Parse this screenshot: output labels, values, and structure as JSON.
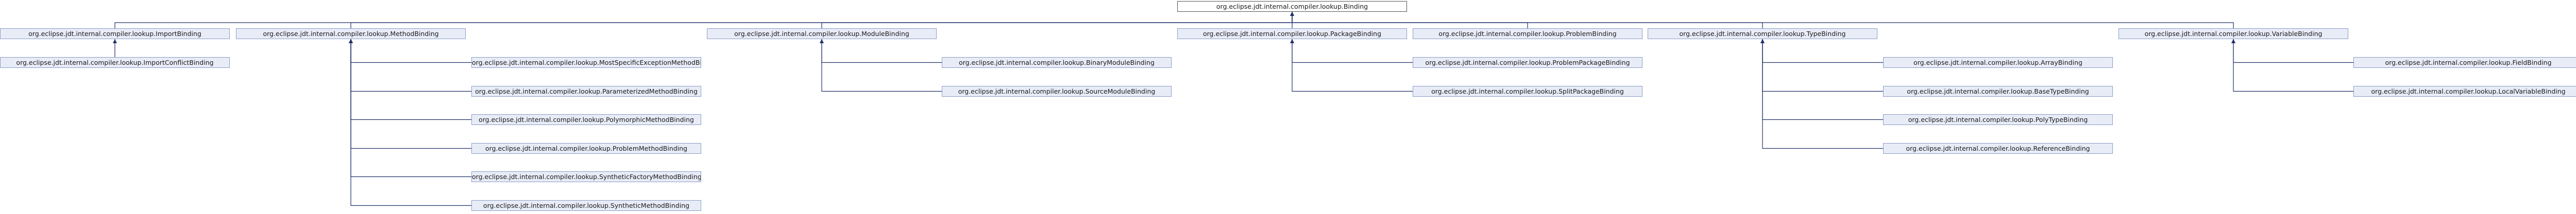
{
  "diagram": {
    "root": "org.eclipse.jdt.internal.compiler.lookup.Binding",
    "nodes": [
      {
        "id": "binding",
        "label": "org.eclipse.jdt.internal.compiler.lookup.Binding"
      },
      {
        "id": "import",
        "label": "org.eclipse.jdt.internal.compiler.lookup.ImportBinding"
      },
      {
        "id": "method",
        "label": "org.eclipse.jdt.internal.compiler.lookup.MethodBinding"
      },
      {
        "id": "module",
        "label": "org.eclipse.jdt.internal.compiler.lookup.ModuleBinding"
      },
      {
        "id": "package",
        "label": "org.eclipse.jdt.internal.compiler.lookup.PackageBinding"
      },
      {
        "id": "problem",
        "label": "org.eclipse.jdt.internal.compiler.lookup.ProblemBinding"
      },
      {
        "id": "type",
        "label": "org.eclipse.jdt.internal.compiler.lookup.TypeBinding"
      },
      {
        "id": "variable",
        "label": "org.eclipse.jdt.internal.compiler.lookup.VariableBinding"
      },
      {
        "id": "importConflict",
        "label": "org.eclipse.jdt.internal.compiler.lookup.ImportConflictBinding"
      },
      {
        "id": "mostSpecific",
        "label": "org.eclipse.jdt.internal.compiler.lookup.MostSpecificExceptionMethodBinding"
      },
      {
        "id": "parameterized",
        "label": "org.eclipse.jdt.internal.compiler.lookup.ParameterizedMethodBinding"
      },
      {
        "id": "polymorphic",
        "label": "org.eclipse.jdt.internal.compiler.lookup.PolymorphicMethodBinding"
      },
      {
        "id": "problemMethod",
        "label": "org.eclipse.jdt.internal.compiler.lookup.ProblemMethodBinding"
      },
      {
        "id": "syntheticFactory",
        "label": "org.eclipse.jdt.internal.compiler.lookup.SyntheticFactoryMethodBinding"
      },
      {
        "id": "syntheticMethod",
        "label": "org.eclipse.jdt.internal.compiler.lookup.SyntheticMethodBinding"
      },
      {
        "id": "binaryModule",
        "label": "org.eclipse.jdt.internal.compiler.lookup.BinaryModuleBinding"
      },
      {
        "id": "sourceModule",
        "label": "org.eclipse.jdt.internal.compiler.lookup.SourceModuleBinding"
      },
      {
        "id": "problemPackage",
        "label": "org.eclipse.jdt.internal.compiler.lookup.ProblemPackageBinding"
      },
      {
        "id": "splitPackage",
        "label": "org.eclipse.jdt.internal.compiler.lookup.SplitPackageBinding"
      },
      {
        "id": "array",
        "label": "org.eclipse.jdt.internal.compiler.lookup.ArrayBinding"
      },
      {
        "id": "baseType",
        "label": "org.eclipse.jdt.internal.compiler.lookup.BaseTypeBinding"
      },
      {
        "id": "polyType",
        "label": "org.eclipse.jdt.internal.compiler.lookup.PolyTypeBinding"
      },
      {
        "id": "reference",
        "label": "org.eclipse.jdt.internal.compiler.lookup.ReferenceBinding"
      },
      {
        "id": "field",
        "label": "org.eclipse.jdt.internal.compiler.lookup.FieldBinding"
      },
      {
        "id": "localVariable",
        "label": "org.eclipse.jdt.internal.compiler.lookup.LocalVariableBinding"
      }
    ],
    "edges": [
      {
        "from": "import",
        "to": "binding"
      },
      {
        "from": "method",
        "to": "binding"
      },
      {
        "from": "module",
        "to": "binding"
      },
      {
        "from": "package",
        "to": "binding"
      },
      {
        "from": "problem",
        "to": "binding"
      },
      {
        "from": "type",
        "to": "binding"
      },
      {
        "from": "variable",
        "to": "binding"
      },
      {
        "from": "importConflict",
        "to": "import"
      },
      {
        "from": "mostSpecific",
        "to": "method"
      },
      {
        "from": "parameterized",
        "to": "method"
      },
      {
        "from": "polymorphic",
        "to": "method"
      },
      {
        "from": "problemMethod",
        "to": "method"
      },
      {
        "from": "syntheticFactory",
        "to": "method"
      },
      {
        "from": "syntheticMethod",
        "to": "method"
      },
      {
        "from": "binaryModule",
        "to": "module"
      },
      {
        "from": "sourceModule",
        "to": "module"
      },
      {
        "from": "problemPackage",
        "to": "package"
      },
      {
        "from": "splitPackage",
        "to": "package"
      },
      {
        "from": "array",
        "to": "type"
      },
      {
        "from": "baseType",
        "to": "type"
      },
      {
        "from": "polyType",
        "to": "type"
      },
      {
        "from": "reference",
        "to": "type"
      },
      {
        "from": "field",
        "to": "variable"
      },
      {
        "from": "localVariable",
        "to": "variable"
      }
    ]
  }
}
